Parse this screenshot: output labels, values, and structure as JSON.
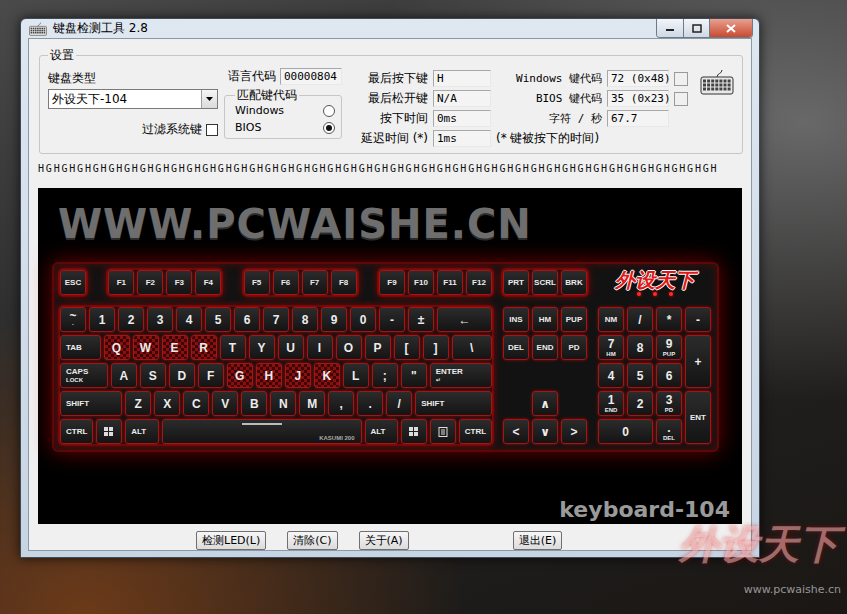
{
  "window": {
    "title": "键盘检测工具 2.8"
  },
  "settings": {
    "title": "设置",
    "keyboard_type": {
      "label": "键盘类型",
      "value": "外设天下-104"
    },
    "filter_system_keys": {
      "label": "过滤系统键",
      "checked": false
    },
    "language_code": {
      "label": "语言代码",
      "value": "00000804"
    },
    "match_key_code": {
      "title": "匹配键代码",
      "options": [
        {
          "label": "Windows",
          "selected": false
        },
        {
          "label": "BIOS",
          "selected": true
        }
      ]
    },
    "stats": [
      {
        "label": "最后按下键",
        "value": "H"
      },
      {
        "label": "最后松开键",
        "value": "N/A"
      },
      {
        "label": "按下时间",
        "value": "0ms"
      },
      {
        "label": "延迟时间 (*)",
        "value": "1ms"
      }
    ],
    "codes": [
      {
        "label": "Windows 键代码",
        "value": "72 (0x48)",
        "kind": "swatch"
      },
      {
        "label": "BIOS 键代码",
        "value": "35 (0x23)",
        "kind": "swatch"
      },
      {
        "label": "字符 / 秒",
        "value": "67.7",
        "kind": "plain"
      }
    ],
    "delay_note": "(* 键被按下的时间)"
  },
  "key_log": "HGHGHGHGHGHGHGHGHGHGHGHGHGHGHGHGHGHGHGHGHGHGHGHGHGHGHGHGHGHGHGHGHGHGHGHGHGHGHGHGHGHGHGH",
  "keyboard": {
    "site": "WWW.PCWAISHE.CN",
    "brand": "外设天下",
    "model_label": "keyboard-104",
    "function_row": [
      {
        "keys": [
          {
            "label": "ESC",
            "kind": "key",
            "pressed": false
          }
        ]
      },
      {
        "keys": [
          {
            "label": "F1",
            "kind": "key",
            "pressed": false
          },
          {
            "label": "F2",
            "kind": "key",
            "pressed": false
          },
          {
            "label": "F3",
            "kind": "key",
            "pressed": false
          },
          {
            "label": "F4",
            "kind": "key",
            "pressed": false
          }
        ]
      },
      {
        "keys": [
          {
            "label": "F5",
            "kind": "key",
            "pressed": false
          },
          {
            "label": "F6",
            "kind": "key",
            "pressed": false
          },
          {
            "label": "F7",
            "kind": "key",
            "pressed": false
          },
          {
            "label": "F8",
            "kind": "key",
            "pressed": false
          }
        ]
      },
      {
        "keys": [
          {
            "label": "F9",
            "kind": "key",
            "pressed": false
          },
          {
            "label": "F10",
            "kind": "key",
            "pressed": false
          },
          {
            "label": "F11",
            "kind": "key",
            "pressed": false
          },
          {
            "label": "F12",
            "kind": "key",
            "pressed": false
          }
        ]
      }
    ],
    "system_keys": [
      {
        "label": "PRT",
        "kind": "key",
        "pressed": false
      },
      {
        "label": "SCRL",
        "kind": "key",
        "pressed": false
      },
      {
        "label": "BRK",
        "kind": "key",
        "pressed": false
      }
    ],
    "rows": [
      [
        {
          "label": "~",
          "sub": "`",
          "kind": "key",
          "pressed": false
        },
        {
          "label": "1",
          "kind": "key",
          "pressed": false
        },
        {
          "label": "2",
          "kind": "key",
          "pressed": false
        },
        {
          "label": "3",
          "kind": "key",
          "pressed": false
        },
        {
          "label": "4",
          "kind": "key",
          "pressed": false
        },
        {
          "label": "5",
          "kind": "key",
          "pressed": false
        },
        {
          "label": "6",
          "kind": "key",
          "pressed": false
        },
        {
          "label": "7",
          "kind": "key",
          "pressed": false
        },
        {
          "label": "8",
          "kind": "key",
          "pressed": false
        },
        {
          "label": "9",
          "kind": "key",
          "pressed": false
        },
        {
          "label": "0",
          "kind": "key",
          "pressed": false
        },
        {
          "label": "-",
          "kind": "key",
          "pressed": false
        },
        {
          "label": "±",
          "kind": "key",
          "pressed": false
        },
        {
          "label": "←",
          "kind": "backspace",
          "pressed": false
        }
      ],
      [
        {
          "label": "TAB",
          "kind": "tab",
          "pressed": false
        },
        {
          "label": "Q",
          "kind": "key",
          "pressed": true
        },
        {
          "label": "W",
          "kind": "key",
          "pressed": true
        },
        {
          "label": "E",
          "kind": "key",
          "pressed": true
        },
        {
          "label": "R",
          "kind": "key",
          "pressed": true
        },
        {
          "label": "T",
          "kind": "key",
          "pressed": false
        },
        {
          "label": "Y",
          "kind": "key",
          "pressed": false
        },
        {
          "label": "U",
          "kind": "key",
          "pressed": false
        },
        {
          "label": "I",
          "kind": "key",
          "pressed": false
        },
        {
          "label": "O",
          "kind": "key",
          "pressed": false
        },
        {
          "label": "P",
          "kind": "key",
          "pressed": false
        },
        {
          "label": "[",
          "kind": "key",
          "pressed": false
        },
        {
          "label": "]",
          "kind": "key",
          "pressed": false
        },
        {
          "label": "\\",
          "kind": "backslash",
          "pressed": false
        }
      ],
      [
        {
          "label": "CAPS",
          "sub": "LOCK",
          "kind": "caps",
          "pressed": false
        },
        {
          "label": "A",
          "kind": "key",
          "pressed": false
        },
        {
          "label": "S",
          "kind": "key",
          "pressed": false
        },
        {
          "label": "D",
          "kind": "key",
          "pressed": false
        },
        {
          "label": "F",
          "kind": "key",
          "pressed": false
        },
        {
          "label": "G",
          "kind": "key",
          "pressed": true
        },
        {
          "label": "H",
          "kind": "key",
          "pressed": true
        },
        {
          "label": "J",
          "kind": "key",
          "pressed": true
        },
        {
          "label": "K",
          "kind": "key",
          "pressed": true
        },
        {
          "label": "L",
          "kind": "key",
          "pressed": false
        },
        {
          "label": ";",
          "kind": "key",
          "pressed": false
        },
        {
          "label": "\"",
          "kind": "key",
          "pressed": false
        },
        {
          "label": "ENTER",
          "sub": "↵",
          "kind": "enter",
          "pressed": false
        }
      ],
      [
        {
          "label": "SHIFT",
          "kind": "lshift",
          "pressed": false
        },
        {
          "label": "Z",
          "kind": "key",
          "pressed": false
        },
        {
          "label": "X",
          "kind": "key",
          "pressed": false
        },
        {
          "label": "C",
          "kind": "key",
          "pressed": false
        },
        {
          "label": "V",
          "kind": "key",
          "pressed": false
        },
        {
          "label": "B",
          "kind": "key",
          "pressed": false
        },
        {
          "label": "N",
          "kind": "key",
          "pressed": false
        },
        {
          "label": "M",
          "kind": "key",
          "pressed": false
        },
        {
          "label": ",",
          "kind": "key",
          "pressed": false
        },
        {
          "label": ".",
          "kind": "key",
          "pressed": false
        },
        {
          "label": "/",
          "kind": "key",
          "pressed": false
        },
        {
          "label": "SHIFT",
          "kind": "rshift",
          "pressed": false
        }
      ],
      [
        {
          "label": "CTRL",
          "kind": "mod",
          "pressed": false
        },
        {
          "kind": "win",
          "pressed": false
        },
        {
          "label": "ALT",
          "kind": "mod",
          "pressed": false
        },
        {
          "label": "KASUMI 200",
          "kind": "space",
          "pressed": false
        },
        {
          "label": "ALT",
          "kind": "mod",
          "pressed": false
        },
        {
          "kind": "win",
          "pressed": false
        },
        {
          "kind": "menu",
          "pressed": false
        },
        {
          "label": "CTRL",
          "kind": "mod",
          "pressed": false
        }
      ]
    ],
    "navigation": [
      {
        "label": "INS",
        "kind": "key",
        "pressed": false
      },
      {
        "label": "HM",
        "kind": "key",
        "pressed": false
      },
      {
        "label": "PUP",
        "kind": "key",
        "pressed": false
      },
      {
        "label": "DEL",
        "kind": "key",
        "pressed": false
      },
      {
        "label": "END",
        "kind": "key",
        "pressed": false
      },
      {
        "label": "PD",
        "kind": "key",
        "pressed": false
      },
      {
        "label": "∧",
        "kind": "arrow-up",
        "pressed": false
      },
      {
        "label": "<",
        "kind": "arrow",
        "pressed": false
      },
      {
        "label": "∨",
        "kind": "arrow",
        "pressed": false
      },
      {
        "label": ">",
        "kind": "arrow",
        "pressed": false
      }
    ],
    "numpad": [
      {
        "label": "NM",
        "kind": "key",
        "pressed": false
      },
      {
        "label": "/",
        "kind": "key",
        "pressed": false
      },
      {
        "label": "*",
        "kind": "key",
        "pressed": false
      },
      {
        "label": "-",
        "kind": "key",
        "pressed": false
      },
      {
        "label": "7",
        "sub": "HM",
        "kind": "key",
        "pressed": false
      },
      {
        "label": "8",
        "kind": "key",
        "pressed": false
      },
      {
        "label": "9",
        "sub": "PUP",
        "kind": "key",
        "pressed": false
      },
      {
        "label": "+",
        "kind": "tall",
        "pressed": false
      },
      {
        "label": "4",
        "kind": "key",
        "pressed": false
      },
      {
        "label": "5",
        "kind": "key",
        "pressed": false
      },
      {
        "label": "6",
        "kind": "key",
        "pressed": false
      },
      {
        "label": "1",
        "sub": "END",
        "kind": "key",
        "pressed": false
      },
      {
        "label": "2",
        "kind": "key",
        "pressed": false
      },
      {
        "label": "3",
        "sub": "PD",
        "kind": "key",
        "pressed": false
      },
      {
        "label": "ENT",
        "kind": "tall",
        "pressed": false
      },
      {
        "label": "0",
        "kind": "double",
        "pressed": false
      },
      {
        "label": ".",
        "sub": "DEL",
        "kind": "key",
        "pressed": false
      }
    ]
  },
  "buttons": [
    {
      "label": "检测LED(L)"
    },
    {
      "label": "清除(C)"
    },
    {
      "label": "关于(A)"
    },
    {
      "label": "退出(E)"
    }
  ],
  "watermark": {
    "brand": "外设天下",
    "url": "www.pcwaishe.cn"
  }
}
